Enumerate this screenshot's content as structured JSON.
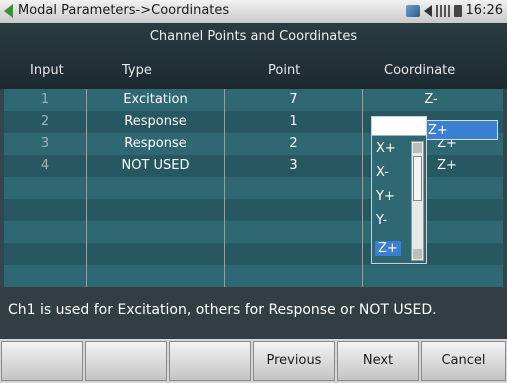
{
  "titlebar": {
    "title": "Modal Parameters->Coordinates",
    "time": "16:26"
  },
  "table": {
    "caption": "Channel Points and Coordinates",
    "headers": {
      "input": "Input",
      "type": "Type",
      "point": "Point",
      "coordinate": "Coordinate"
    },
    "rows": [
      {
        "input": "1",
        "type": "Excitation",
        "point": "7",
        "coordinate": "Z-"
      },
      {
        "input": "2",
        "type": "Response",
        "point": "1",
        "coordinate": "Z+"
      },
      {
        "input": "3",
        "type": "Response",
        "point": "2",
        "coordinate": "Z+"
      },
      {
        "input": "4",
        "type": "NOT USED",
        "point": "3",
        "coordinate": "Z+"
      }
    ]
  },
  "dropdown": {
    "options": [
      "X+",
      "X-",
      "Y+",
      "Y-",
      "Z+"
    ],
    "selected": "Z+"
  },
  "info": "Ch1 is used for Excitation, others for Response or NOT USED.",
  "softkeys": [
    "",
    "",
    "",
    "Previous",
    "Next",
    "Cancel"
  ],
  "colors": {
    "accent": "#3b7fd0",
    "grid": "#2f6772",
    "background": "#34444a"
  }
}
